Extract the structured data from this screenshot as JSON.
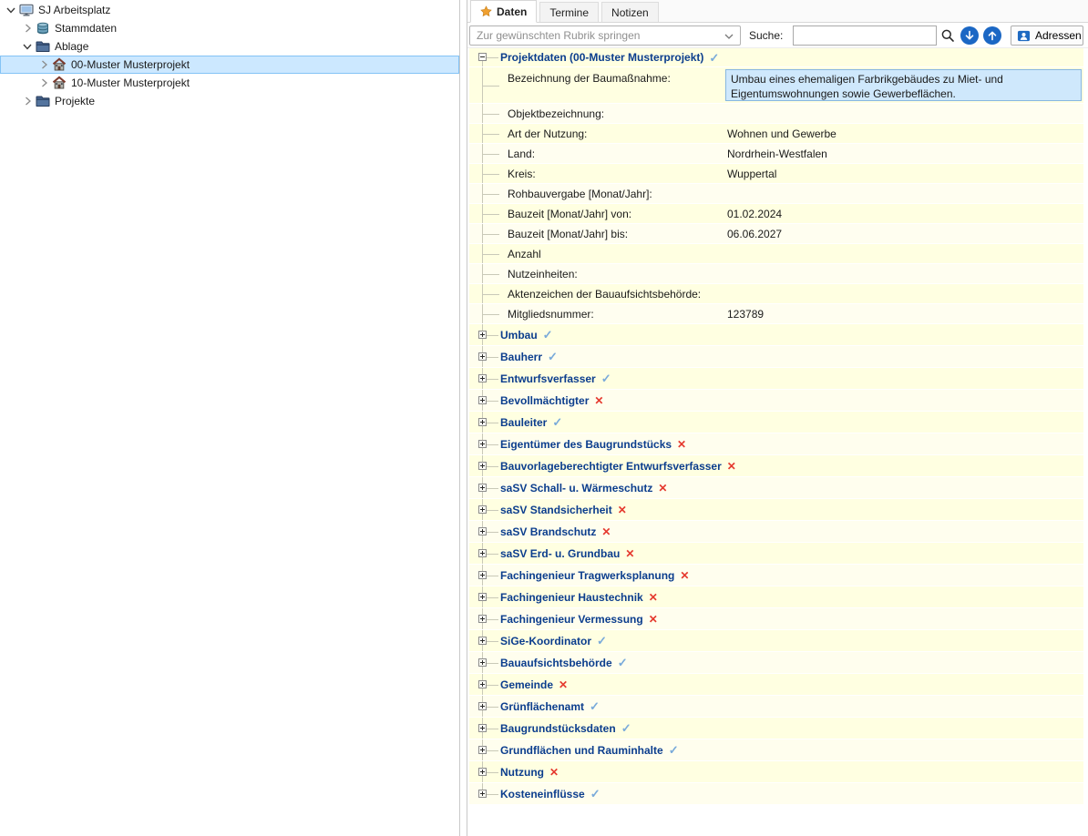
{
  "left_tree": {
    "items": [
      {
        "label": "SJ Arbeitsplatz",
        "level": 0,
        "expander": "expanded",
        "icon": "computer-icon",
        "selected": false
      },
      {
        "label": "Stammdaten",
        "level": 1,
        "expander": "collapsed",
        "icon": "database-icon",
        "selected": false
      },
      {
        "label": "Ablage",
        "level": 1,
        "expander": "expanded",
        "icon": "folder-icon",
        "selected": false
      },
      {
        "label": "00-Muster Musterprojekt",
        "level": 2,
        "expander": "collapsed",
        "icon": "house-icon",
        "selected": true
      },
      {
        "label": "10-Muster Musterprojekt",
        "level": 2,
        "expander": "collapsed",
        "icon": "house-icon",
        "selected": false
      },
      {
        "label": "Projekte",
        "level": 1,
        "expander": "collapsed",
        "icon": "folder-icon",
        "selected": false
      }
    ]
  },
  "tabs": [
    {
      "label": "Daten",
      "active": true,
      "icon": "star-icon"
    },
    {
      "label": "Termine",
      "active": false
    },
    {
      "label": "Notizen",
      "active": false
    }
  ],
  "toolbar": {
    "rubrik_placeholder": "Zur gewünschten Rubrik springen",
    "suche_label": "Suche:",
    "search_value": "",
    "adressen_label": "Adressen",
    "icons": [
      "chevron-down-icon",
      "search-icon",
      "arrow-down-circle-icon",
      "arrow-up-circle-icon",
      "contact-card-icon"
    ]
  },
  "form": {
    "header": {
      "label": "Projektdaten (00-Muster Musterprojekt)",
      "status": "check"
    },
    "fields": [
      {
        "label": "Bezeichnung der Baumaßnahme:",
        "value": "Umbau eines ehemaligen Farbrikgebäudes zu Miet- und Eigentumswohnungen sowie Gewerbeflächen.",
        "highlighted": true,
        "tall": true
      },
      {
        "label": "Objektbezeichnung:",
        "value": ""
      },
      {
        "label": "Art der Nutzung:",
        "value": "Wohnen und Gewerbe"
      },
      {
        "label": "Land:",
        "value": "Nordrhein-Westfalen"
      },
      {
        "label": "Kreis:",
        "value": "Wuppertal"
      },
      {
        "label": "Rohbauvergabe [Monat/Jahr]:",
        "value": ""
      },
      {
        "label": "Bauzeit [Monat/Jahr] von:",
        "value": "01.02.2024"
      },
      {
        "label": "Bauzeit [Monat/Jahr] bis:",
        "value": "06.06.2027"
      },
      {
        "label": "Anzahl",
        "value": ""
      },
      {
        "label": "Nutzeinheiten:",
        "value": ""
      },
      {
        "label": "Aktenzeichen der Bauaufsichtsbehörde:",
        "value": ""
      },
      {
        "label": "Mitgliedsnummer:",
        "value": "123789"
      }
    ],
    "categories": [
      {
        "label": "Umbau",
        "status": "check"
      },
      {
        "label": "Bauherr",
        "status": "check"
      },
      {
        "label": "Entwurfsverfasser",
        "status": "check"
      },
      {
        "label": "Bevollmächtigter",
        "status": "cross"
      },
      {
        "label": "Bauleiter",
        "status": "check"
      },
      {
        "label": "Eigentümer des Baugrundstücks",
        "status": "cross"
      },
      {
        "label": "Bauvorlageberechtigter Entwurfsverfasser",
        "status": "cross"
      },
      {
        "label": "saSV Schall- u. Wärmeschutz",
        "status": "cross"
      },
      {
        "label": "saSV Standsicherheit",
        "status": "cross"
      },
      {
        "label": "saSV Brandschutz",
        "status": "cross"
      },
      {
        "label": "saSV Erd- u. Grundbau",
        "status": "cross"
      },
      {
        "label": "Fachingenieur Tragwerksplanung",
        "status": "cross"
      },
      {
        "label": "Fachingenieur Haustechnik",
        "status": "cross"
      },
      {
        "label": "Fachingenieur Vermessung",
        "status": "cross"
      },
      {
        "label": "SiGe-Koordinator",
        "status": "check"
      },
      {
        "label": "Bauaufsichtsbehörde",
        "status": "check"
      },
      {
        "label": "Gemeinde",
        "status": "cross"
      },
      {
        "label": "Grünflächenamt",
        "status": "check"
      },
      {
        "label": "Baugrundstücksdaten",
        "status": "check"
      },
      {
        "label": "Grundflächen und Rauminhalte",
        "status": "check"
      },
      {
        "label": "Nutzung",
        "status": "cross"
      },
      {
        "label": "Kosteneinflüsse",
        "status": "check"
      }
    ]
  },
  "colors": {
    "row_yellow": "#ffffe1",
    "selection_blue": "#cce8ff",
    "field_highlight": "#cfe8fc",
    "category_text": "#0b3d8d",
    "check_blue": "#79aada",
    "cross_red": "#e5392e",
    "button_blue": "#1b67c4",
    "star_orange": "#f0a030"
  }
}
